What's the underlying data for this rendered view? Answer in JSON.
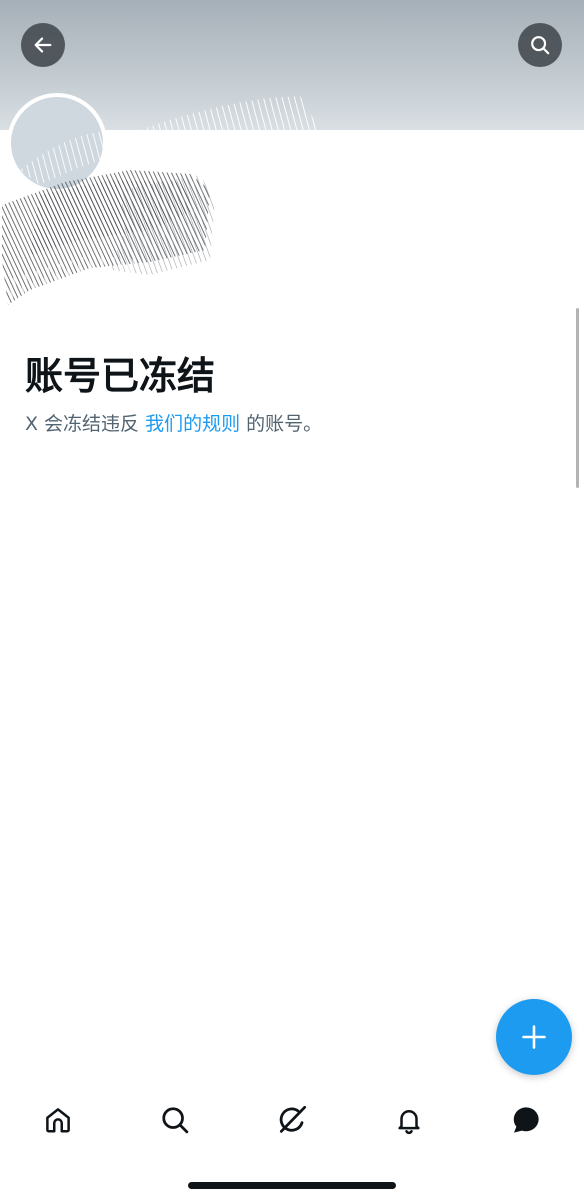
{
  "profile": {
    "title": "账号已冻结",
    "desc_prefix": "X 会冻结违反",
    "desc_link": "我们的规则",
    "desc_suffix": "的账号。"
  },
  "icons": {
    "back": "arrow-left-icon",
    "search": "search-icon",
    "compose": "plus-icon",
    "tabs": [
      "home-icon",
      "search-icon",
      "grok-icon",
      "bell-icon",
      "messages-icon"
    ]
  },
  "colors": {
    "accent": "#1d9bf0",
    "text_primary": "#0f1419",
    "text_secondary": "#536471",
    "banner": "#c1c9cf"
  }
}
